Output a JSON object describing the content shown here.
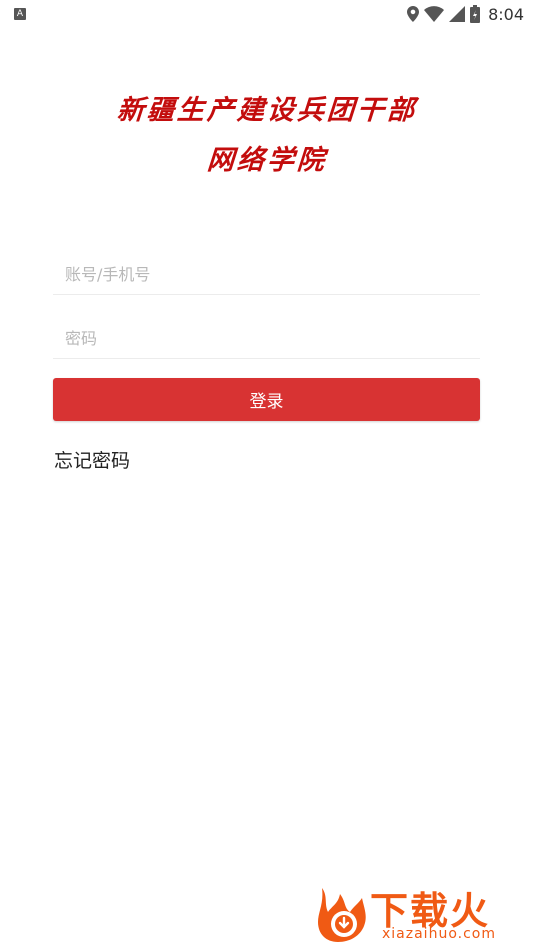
{
  "status_bar": {
    "notification_icon": "a-icon",
    "notification_letter": "A",
    "time": "8:04",
    "icons": [
      "location-icon",
      "wifi-icon",
      "signal-icon",
      "battery-icon"
    ]
  },
  "header": {
    "title_line1": "新疆生产建设兵团干部",
    "title_line2": "网络学院",
    "title_color": "#c30d0d"
  },
  "form": {
    "account_placeholder": "账号/手机号",
    "account_value": "",
    "password_placeholder": "密码",
    "password_value": "",
    "login_label": "登录",
    "login_color": "#d83333",
    "forgot_label": "忘记密码"
  },
  "watermark": {
    "logo_icon": "xiazaihuo-logo-icon",
    "brand": "下载火",
    "url": "xiazaihuo.com",
    "color": "#f05a14"
  }
}
